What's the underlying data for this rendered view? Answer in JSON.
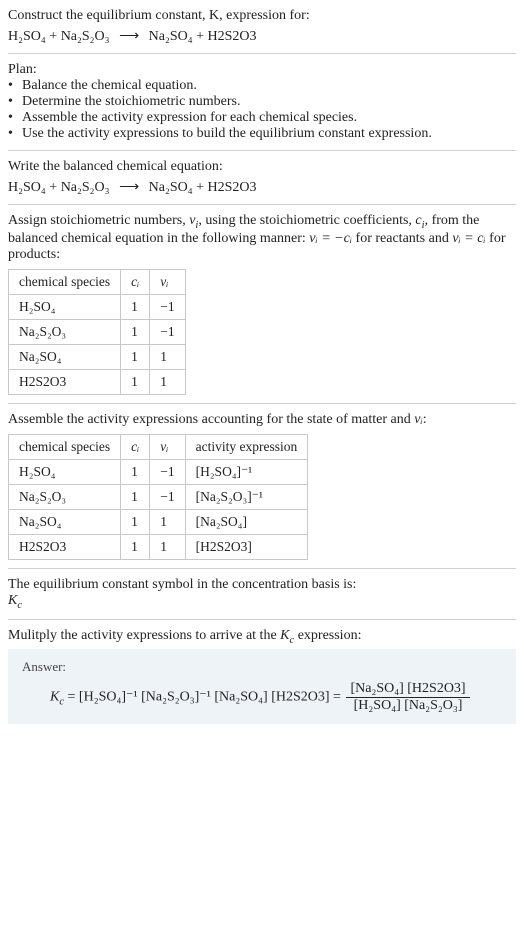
{
  "header": {
    "prompt": "Construct the equilibrium constant, K, expression for:",
    "equation_lhs_1": "H₂SO₄",
    "plus": " + ",
    "equation_lhs_2": "Na₂S₂O₃",
    "arrow": "⟶",
    "equation_rhs_1": "Na₂SO₄",
    "equation_rhs_2": "H2S2O3"
  },
  "plan": {
    "title": "Plan:",
    "items": [
      "Balance the chemical equation.",
      "Determine the stoichiometric numbers.",
      "Assemble the activity expression for each chemical species.",
      "Use the activity expressions to build the equilibrium constant expression."
    ]
  },
  "balanced": {
    "title": "Write the balanced chemical equation:",
    "lhs_1": "H₂SO₄",
    "lhs_2": "Na₂S₂O₃",
    "rhs_1": "Na₂SO₄",
    "rhs_2": "H2S2O3"
  },
  "stoich": {
    "intro_a": "Assign stoichiometric numbers, ",
    "nu": "ν",
    "sub_i": "i",
    "intro_b": ", using the stoichiometric coefficients, ",
    "c": "c",
    "intro_c": ", from the balanced chemical equation in the following manner: ",
    "rel1": "νᵢ = −cᵢ",
    "intro_d": " for reactants and ",
    "rel2": "νᵢ = cᵢ",
    "intro_e": " for products:",
    "table": {
      "headers": [
        "chemical species",
        "cᵢ",
        "νᵢ"
      ],
      "rows": [
        [
          "H₂SO₄",
          "1",
          "−1"
        ],
        [
          "Na₂S₂O₃",
          "1",
          "−1"
        ],
        [
          "Na₂SO₄",
          "1",
          "1"
        ],
        [
          "H2S2O3",
          "1",
          "1"
        ]
      ]
    }
  },
  "activity": {
    "intro_a": "Assemble the activity expressions accounting for the state of matter and ",
    "nu": "νᵢ",
    "intro_b": ":",
    "table": {
      "headers": [
        "chemical species",
        "cᵢ",
        "νᵢ",
        "activity expression"
      ],
      "rows": [
        [
          "H₂SO₄",
          "1",
          "−1",
          "[H₂SO₄]⁻¹"
        ],
        [
          "Na₂S₂O₃",
          "1",
          "−1",
          "[Na₂S₂O₃]⁻¹"
        ],
        [
          "Na₂SO₄",
          "1",
          "1",
          "[Na₂SO₄]"
        ],
        [
          "H2S2O3",
          "1",
          "1",
          "[H2S2O3]"
        ]
      ]
    }
  },
  "symbol": {
    "line": "The equilibrium constant symbol in the concentration basis is:",
    "kc": "K_c"
  },
  "multiply": {
    "line_a": "Mulitply the activity expressions to arrive at the ",
    "kc": "K_c",
    "line_b": " expression:"
  },
  "answer": {
    "label": "Answer:",
    "kc": "K_c",
    "eq": " = ",
    "t1": "[H₂SO₄]⁻¹",
    "t2": "[Na₂S₂O₃]⁻¹",
    "t3": "[Na₂SO₄]",
    "t4": "[H2S2O3]",
    "frac_num_a": "[Na₂SO₄]",
    "frac_num_b": "[H2S2O3]",
    "frac_den_a": "[H₂SO₄]",
    "frac_den_b": "[Na₂S₂O₃]"
  }
}
